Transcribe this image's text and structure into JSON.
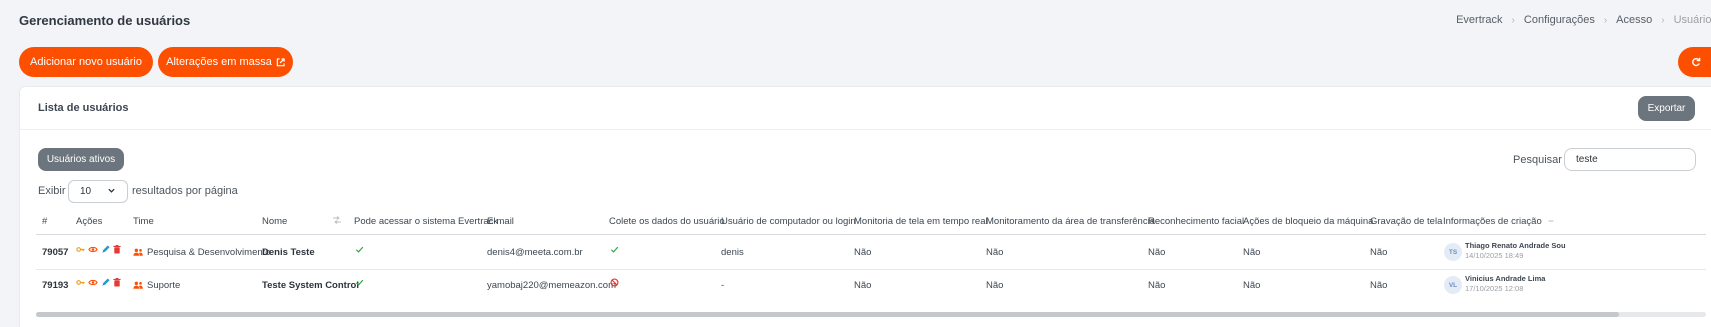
{
  "page": {
    "title": "Gerenciamento de usuários"
  },
  "breadcrumb": [
    "Evertrack",
    "Configurações",
    "Acesso",
    "Usuários"
  ],
  "toolbar": {
    "add_label": "Adicionar novo usuário",
    "mass_label": "Alterações em massa"
  },
  "card": {
    "title": "Lista de usuários",
    "export_label": "Exportar"
  },
  "filters": {
    "active_label": "Usuários ativos",
    "search_label": "Pesquisar",
    "search_value": "teste",
    "show_label": "Exibir",
    "per_page": "10",
    "results_label": "resultados por página"
  },
  "table": {
    "columns": [
      "#",
      "Ações",
      "Time",
      "Nome",
      "Pode acessar o sistema Evertrack",
      "E-mail",
      "Colete os dados do usuário",
      "Usuário de computador ou login",
      "Monitoria de tela em tempo real",
      "Monitoramento da área de transferência",
      "Reconhecimento facial",
      "Ações de bloqueio da máquina",
      "Gravação de tela",
      "Informações de criação"
    ],
    "rows": [
      {
        "id": "79057",
        "team": "Pesquisa & Desenvolvimento",
        "name": "Denis Teste",
        "can_access": "check",
        "email": "denis4@meeta.com.br",
        "collect": "check",
        "login": "denis",
        "screen_monitor": "Não",
        "clipboard": "Não",
        "face": "Não",
        "block": "Não",
        "recording": "Não",
        "creator_initials": "TS",
        "creator_name": "Thiago Renato Andrade Sou",
        "creator_date": "14/10/2025 18:49"
      },
      {
        "id": "79193",
        "team": "Suporte",
        "name": "Teste System Control",
        "can_access": "check",
        "email": "yamobaj220@memeazon.com",
        "collect": "blocked",
        "login": "-",
        "screen_monitor": "Não",
        "clipboard": "Não",
        "face": "Não",
        "block": "Não",
        "recording": "Não",
        "creator_initials": "VL",
        "creator_name": "Vinicius Andrade Lima",
        "creator_date": "17/10/2025 12:08"
      }
    ]
  },
  "colors": {
    "accent": "#fd4f00",
    "secondary": "#6c757d",
    "success": "#28a745",
    "danger": "#e53935"
  }
}
